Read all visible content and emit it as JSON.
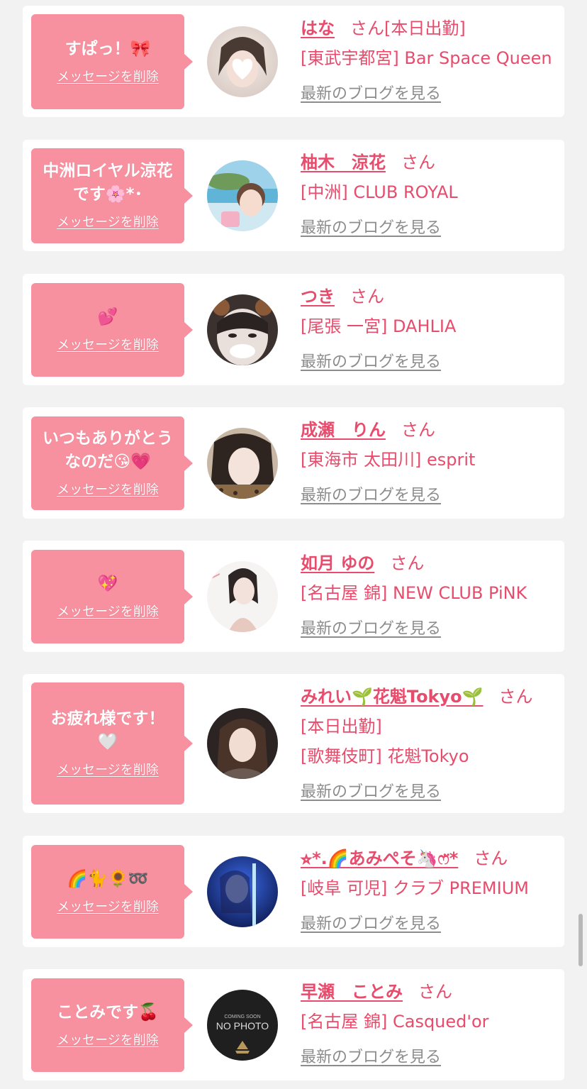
{
  "delete_label": "メッセージを削除",
  "blog_label": "最新のブログを見る",
  "honorific": "さん",
  "colors": {
    "page_bg": "#f2f2f2",
    "card_bg": "#ffffff",
    "bubble": "#f7909f",
    "accent": "#e84c6c",
    "link_gray": "#8c8c8c"
  },
  "messages": [
    {
      "bubble_text": "すぱっ！🎀",
      "name": "はな",
      "name_suffix": "[本日出勤]",
      "lines": [
        "[東武宇都宮] Bar Space Queen"
      ],
      "avatar_icon": "avatar-photo-heart-face"
    },
    {
      "bubble_text": "中洲ロイヤル涼花\nです🌸*･",
      "name": "柚木　涼花",
      "name_suffix": "",
      "lines": [
        "[中洲] CLUB ROYAL"
      ],
      "avatar_icon": "avatar-photo-beach"
    },
    {
      "bubble_text": "💕",
      "name": "つき",
      "name_suffix": "",
      "lines": [
        "[尾張 一宮] DAHLIA"
      ],
      "avatar_icon": "avatar-photo-bear-ears"
    },
    {
      "bubble_text": "いつもありがとう\nなのだ😘💗",
      "name": "成瀬　りん",
      "name_suffix": "",
      "lines": [
        "[東海市 太田川] esprit"
      ],
      "avatar_icon": "avatar-photo-leopard"
    },
    {
      "bubble_text": "💖",
      "name": "如月 ゆの",
      "name_suffix": "",
      "lines": [
        "[名古屋 錦] NEW CLUB PiNK"
      ],
      "avatar_icon": "avatar-photo-white"
    },
    {
      "bubble_text": "お疲れ様です！\n🤍",
      "name": "みれい🌱花魁Tokyo🌱",
      "name_suffix": "",
      "lines": [
        "[本日出勤]",
        "[歌舞伎町] 花魁Tokyo"
      ],
      "avatar_icon": "avatar-photo-dark-hair"
    },
    {
      "bubble_text": "🌈🐈🌻➿",
      "name": "⭐︎*.🌈あみぺそ🦄ෆ̈*",
      "name_suffix": "",
      "lines": [
        "[岐阜 可児] クラブ PREMIUM"
      ],
      "avatar_icon": "avatar-photo-blue-light"
    },
    {
      "bubble_text": "ことみです🍒",
      "name": "早瀬　ことみ",
      "name_suffix": "",
      "lines": [
        "[名古屋 錦] Casqued'or"
      ],
      "avatar_icon": "avatar-no-photo",
      "avatar_text_small": "COMING SOON",
      "avatar_text": "NO PHOTO"
    }
  ]
}
